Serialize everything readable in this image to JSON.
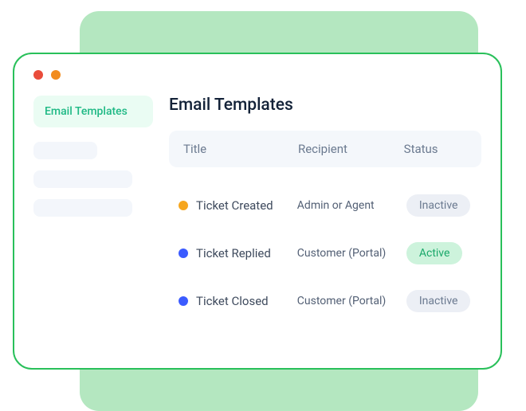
{
  "sidebar": {
    "active_label": "Email Templates"
  },
  "page": {
    "title": "Email Templates"
  },
  "columns": {
    "c0": "Title",
    "c1": "Recipient",
    "c2": "Status"
  },
  "rows": [
    {
      "dot": "orange",
      "title": "Ticket Created",
      "recipient": "Admin or Agent",
      "status": "Inactive",
      "status_kind": "inactive"
    },
    {
      "dot": "blue",
      "title": "Ticket Replied",
      "recipient": "Customer (Portal)",
      "status": "Active",
      "status_kind": "active"
    },
    {
      "dot": "blue",
      "title": "Ticket Closed",
      "recipient": "Customer (Portal)",
      "status": "Inactive",
      "status_kind": "inactive"
    }
  ]
}
